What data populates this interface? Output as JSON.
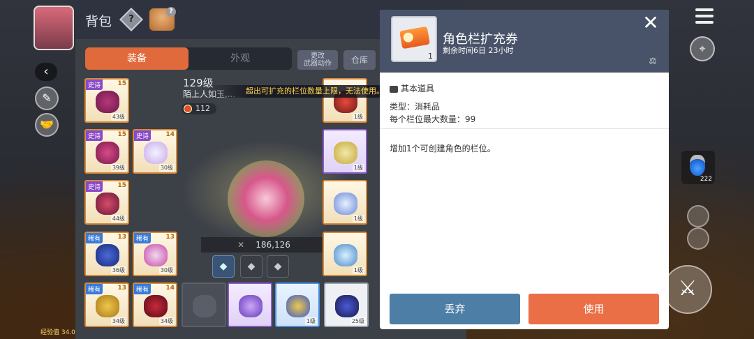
{
  "inventory": {
    "title": "背包",
    "help_symbol": "?",
    "tabs": [
      {
        "label": "装备",
        "active": true
      },
      {
        "label": "外观",
        "active": false
      }
    ],
    "buttons": {
      "change_weapon": "更改\n武器动作",
      "warehouse": "仓库"
    },
    "character": {
      "level": "129级",
      "name": "陌上人如玉,...",
      "power": "112",
      "coordinates": "186,126"
    },
    "slots": [
      {
        "rarity": "史诗",
        "stars": "15",
        "level": "43级"
      },
      {
        "rarity": "史诗",
        "stars": "15",
        "level": "39级"
      },
      {
        "rarity": "史诗",
        "stars": "14",
        "level": "30级"
      },
      {
        "rarity": "史诗",
        "stars": "15",
        "level": "44级"
      },
      {
        "rarity": "稀有",
        "stars": "13",
        "level": "36级"
      },
      {
        "rarity": "稀有",
        "stars": "13",
        "level": "30级"
      },
      {
        "rarity": "稀有",
        "stars": "13",
        "level": "34级"
      },
      {
        "rarity": "稀有",
        "stars": "14",
        "level": "34级"
      }
    ],
    "right_slots": [
      {
        "level": "1级"
      },
      {
        "level": "1级"
      },
      {
        "level": "1级"
      },
      {
        "level": "1级"
      },
      {
        "level": "1级"
      },
      {
        "level": "25级"
      }
    ]
  },
  "notice": "超出可扩充的栏位数量上限，无法使用。",
  "popup": {
    "item_name": "角色栏扩充券",
    "quantity": "1",
    "remaining_time": "剩余时间6日 23小时",
    "category": "其本道具",
    "type_line": "类型：消耗品",
    "max_stack_line": "每个栏位最大数量：99",
    "description": "增加1个可创建角色的栏位。",
    "discard_label": "丢弃",
    "use_label": "使用",
    "close_symbol": "✕"
  },
  "hud": {
    "exp_text": "经验值 34.0%",
    "potion_count": "222"
  },
  "colors": {
    "tab_active": "#e06a3b",
    "discard_button": "#4d7ea5",
    "use_button": "#ea6e46",
    "popup_header": "#485369",
    "notice_text": "#ffd84a"
  }
}
